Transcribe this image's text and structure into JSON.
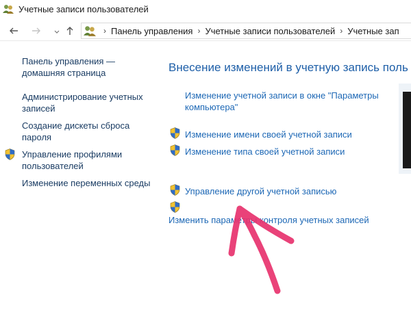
{
  "window": {
    "title": "Учетные записи пользователей"
  },
  "navbar": {
    "back_icon": "arrow-left-icon",
    "forward_icon": "arrow-right-icon",
    "up_icon": "arrow-up-icon",
    "breadcrumbs": [
      "Панель управления",
      "Учетные записи пользователей",
      "Учетные зап"
    ]
  },
  "left_pane": {
    "home_link": "Панель управления — домашняя страница",
    "links": [
      "Администрирование учетных записей",
      "Создание дискеты сброса пароля",
      "Управление профилями пользователей",
      "Изменение переменных среды"
    ]
  },
  "main": {
    "heading": "Внесение изменений в учетную запись поль",
    "tasks": [
      "Изменение учетной записи в окне \"Параметры компьютера\"",
      "Изменение имени своей учетной записи",
      "Изменение типа своей учетной записи",
      "Управление другой учетной записью",
      "Изменить параметры контроля учетных записей"
    ]
  },
  "colors": {
    "heading": "#1e5fa8",
    "link": "#1c67b5",
    "annotation": "#e8336e"
  }
}
